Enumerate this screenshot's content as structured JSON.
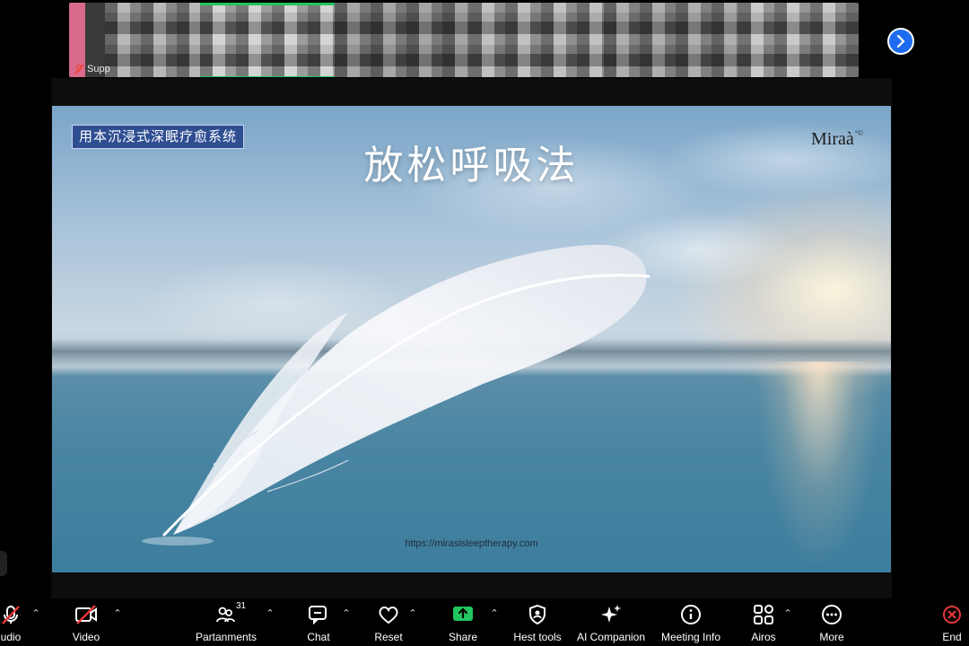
{
  "strip": {
    "participant_name": "Supp"
  },
  "slide": {
    "badge": "用本沉浸式深眠疗愈系统",
    "title": "放松呼吸法",
    "logo": "Miraà",
    "logo_mark": "°©",
    "url": "https://mirasisleeptherapy.com"
  },
  "toolbar": {
    "audio_label": "udio",
    "video_label": "Video",
    "participants_label": "Partanments",
    "participants_count": "31",
    "chat_label": "Chat",
    "reactions_label": "Reset",
    "share_label": "Share",
    "host_tools_label": "Hest tools",
    "ai_companion_label": "AI Companion",
    "meeting_info_label": "Meeting Info",
    "apps_label": "Airos",
    "more_label": "More",
    "end_label": "End"
  },
  "colors": {
    "share_green": "#22c55e",
    "end_red": "#e5383b",
    "nav_blue": "#1e6bf0",
    "badge_blue": "#2f4e92"
  }
}
